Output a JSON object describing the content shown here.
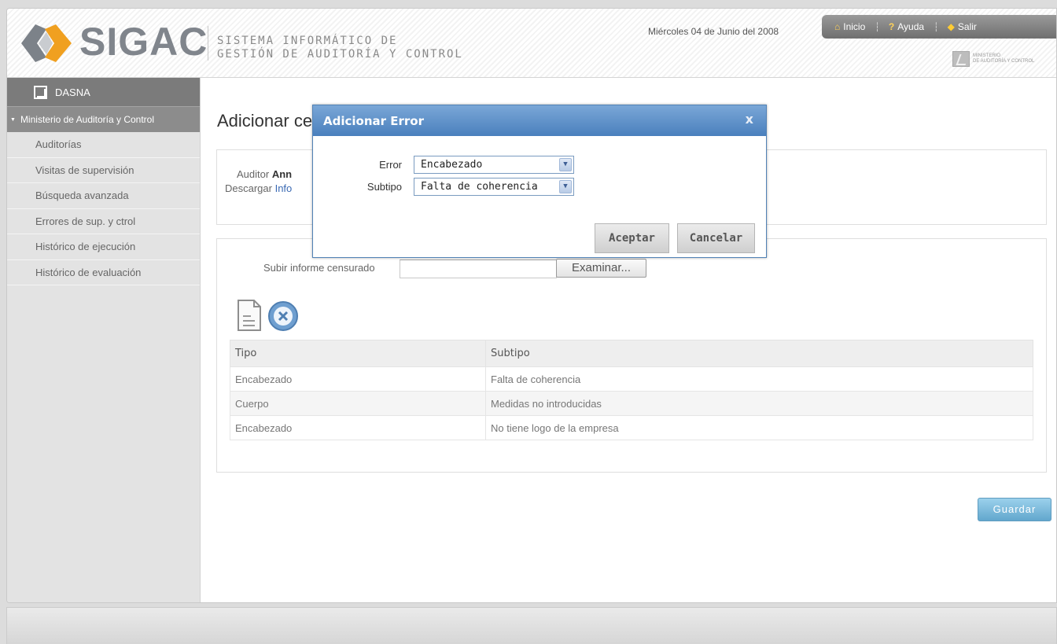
{
  "header": {
    "logo_text": "SIGAC",
    "subtitle_line1": "SISTEMA INFORMÁTICO DE",
    "subtitle_line2": "GESTIÓN DE AUDITORÍA Y CONTROL",
    "date": "Miércoles 04 de Junio del 2008",
    "nav": {
      "home": "Inicio",
      "help": "Ayuda",
      "exit": "Salir"
    },
    "ministry_line1": "MINISTERIO",
    "ministry_line2": "DE AUDITORÍA Y CONTROL"
  },
  "sidebar": {
    "top_label": "DASNA",
    "section_label": "Ministerio de Auditoría y Control",
    "items": [
      {
        "label": "Auditorías"
      },
      {
        "label": "Visitas de supervisión"
      },
      {
        "label": "Búsqueda avanzada"
      },
      {
        "label": "Errores de sup. y ctrol"
      },
      {
        "label": "Histórico de ejecución"
      },
      {
        "label": "Histórico de evaluación"
      }
    ]
  },
  "main": {
    "title": "Adicionar ce",
    "auditor_label": "Auditor",
    "auditor_value": "Ann",
    "download_label": "Descargar",
    "download_link": "Info",
    "upload_label": "Subir informe censurado",
    "browse_label": "Examinar...",
    "table": {
      "headers": [
        "Tipo",
        "Subtipo"
      ],
      "rows": [
        [
          "Encabezado",
          "Falta de coherencia"
        ],
        [
          "Cuerpo",
          "Medidas no introducidas"
        ],
        [
          "Encabezado",
          "No tiene logo de la empresa"
        ]
      ]
    },
    "save_label": "Guardar"
  },
  "modal": {
    "title": "Adicionar Error",
    "close_glyph": "x",
    "error_label": "Error",
    "error_value": "Encabezado",
    "subtype_label": "Subtipo",
    "subtype_value": "Falta de coherencia",
    "accept_label": "Aceptar",
    "cancel_label": "Cancelar"
  },
  "colors": {
    "modal_header": "#4a80bd",
    "sidebar_active": "#8c8c8c",
    "save_button": "#62a7cd",
    "link": "#3b6ab3"
  }
}
